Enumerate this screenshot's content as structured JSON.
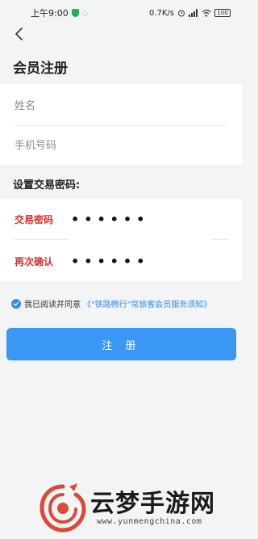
{
  "status_bar": {
    "time": "上午9:00",
    "network_speed": "0.7K/s",
    "battery": "100"
  },
  "header": {
    "title": "会员注册"
  },
  "form": {
    "name_placeholder": "姓名",
    "phone_placeholder": "手机号码"
  },
  "password_section": {
    "title": "设置交易密码:",
    "password_label": "交易密码",
    "password_value": "••••••",
    "confirm_label": "再次确认",
    "confirm_value": "••••••"
  },
  "agreement": {
    "text": "我已阅读并同意",
    "link": "《\"铁路畅行\"常旅客会员服务须知》"
  },
  "register_button": "注 册",
  "watermark": {
    "title": "云梦手游网",
    "url": "www.yunmengchina.com"
  },
  "colors": {
    "accent": "#3a97f3",
    "link": "#2d8cf0",
    "label_red": "#d8312e"
  }
}
